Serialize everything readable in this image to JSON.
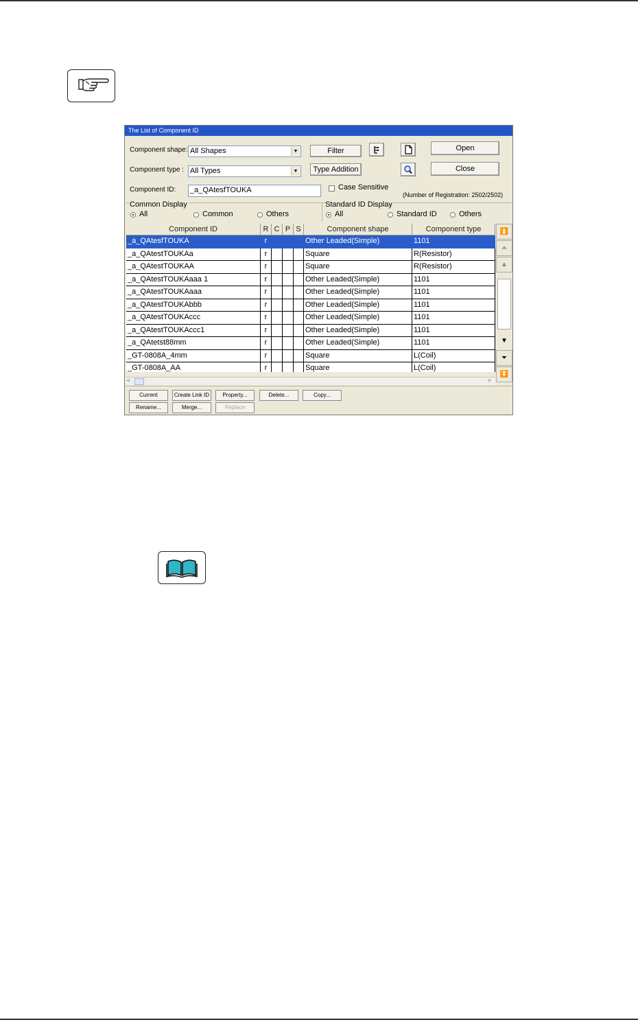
{
  "dialog": {
    "title": "The List of Component ID",
    "labels": {
      "component_shape": "Component shape:",
      "component_type": "Component type :",
      "component_id": "Component ID:"
    },
    "shape_value": "All Shapes",
    "type_value": "All Types",
    "id_value": "_a_QAtesfTOUKA",
    "buttons": {
      "filter": "Filter",
      "type_addition": "Type Addition",
      "open": "Open",
      "close": "Close"
    },
    "case_sensitive": "Case Sensitive",
    "registration": "(Number of Registration:  2502/2502)",
    "common_display": {
      "title": "Common Display",
      "options": [
        "All",
        "Common",
        "Others"
      ]
    },
    "standard_display": {
      "title": "Standard ID Display",
      "options": [
        "All",
        "Standard ID",
        "Others"
      ]
    },
    "table": {
      "headers": [
        "Component ID",
        "R",
        "C",
        "P",
        "S",
        "Component shape",
        "Component type"
      ],
      "rows": [
        [
          "_a_QAtesfTOUKA",
          "r",
          "",
          "",
          "",
          "Other Leaded(Simple)",
          "1101"
        ],
        [
          "_a_QAtestTOUKAa",
          "r",
          "",
          "",
          "",
          "Square",
          "R(Resistor)"
        ],
        [
          "_a_QAtestTOUKAA",
          "r",
          "",
          "",
          "",
          "Square",
          "R(Resistor)"
        ],
        [
          "_a_QAtestTOUKAaaa 1",
          "r",
          "",
          "",
          "",
          "Other Leaded(Simple)",
          "1101"
        ],
        [
          "_a_QAtestTOUKAaaa",
          "r",
          "",
          "",
          "",
          "Other Leaded(Simple)",
          "1101"
        ],
        [
          "_a_QAtestTOUKAbbb",
          "r",
          "",
          "",
          "",
          "Other Leaded(Simple)",
          "1101"
        ],
        [
          "_a_QAtestTOUKAccc",
          "r",
          "",
          "",
          "",
          "Other Leaded(Simple)",
          "1101"
        ],
        [
          "_a_QAtestTOUKAccc1",
          "r",
          "",
          "",
          "",
          "Other Leaded(Simple)",
          "1101"
        ],
        [
          "_a_QAtetst88mm",
          "r",
          "",
          "",
          "",
          "Other Leaded(Simple)",
          "1101"
        ],
        [
          "_GT-0808A_4mm",
          "r",
          "",
          "",
          "",
          "Square",
          "L(Coil)"
        ],
        [
          "_GT-0808A_AA",
          "r",
          "",
          "",
          "",
          "Square",
          "L(Coil)"
        ]
      ]
    },
    "bottom_buttons": {
      "current": "Current",
      "create_link": "Create Link ID",
      "property": "Property...",
      "delete": "Delete...",
      "copy": "Copy...",
      "rename": "Rename...",
      "merge": "Merge...",
      "replace": "Replace"
    }
  }
}
